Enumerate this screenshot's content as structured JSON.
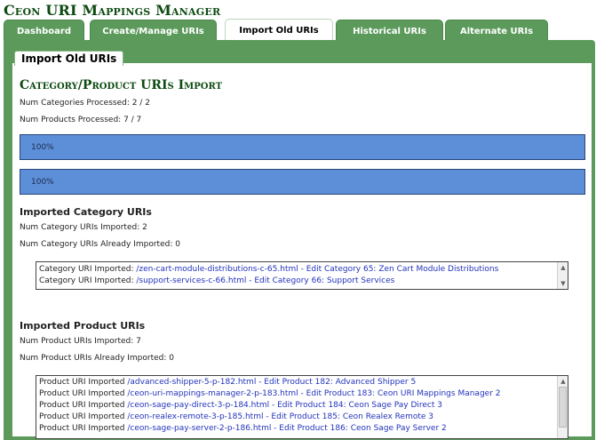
{
  "app": {
    "title": "Ceon URI Mappings Manager"
  },
  "tabs": [
    {
      "label": "Dashboard"
    },
    {
      "label": "Create/Manage URIs"
    },
    {
      "label": "Import Old URIs"
    },
    {
      "label": "Historical URIs"
    },
    {
      "label": "Alternate URIs"
    }
  ],
  "section_tab": "Import Old URIs",
  "heading": "Category/Product URIs Import",
  "stats": {
    "categories_processed": "Num Categories Processed: 2 / 2",
    "products_processed": "Num Products Processed: 7 / 7"
  },
  "progress": [
    {
      "label": "100%",
      "value": 100
    },
    {
      "label": "100%",
      "value": 100
    }
  ],
  "imported_categories": {
    "title": "Imported Category URIs",
    "num_imported": "Num Category URIs Imported: 2",
    "num_already": "Num Category URIs Already Imported: 0",
    "log": [
      {
        "prefix": "Category URI Imported: ",
        "link": "/zen-cart-module-distributions-c-65.html - Edit Category 65: Zen Cart Module Distributions"
      },
      {
        "prefix": "Category URI Imported: ",
        "link": "/support-services-c-66.html - Edit Category 66: Support Services"
      }
    ]
  },
  "imported_products": {
    "title": "Imported Product URIs",
    "num_imported": "Num Product URIs Imported: 7",
    "num_already": "Num Product URIs Already Imported: 0",
    "log": [
      {
        "prefix": "Product URI Imported ",
        "link": "/advanced-shipper-5-p-182.html - Edit Product 182: Advanced Shipper 5"
      },
      {
        "prefix": "Product URI Imported ",
        "link": "/ceon-uri-mappings-manager-2-p-183.html - Edit Product 183: Ceon URI Mappings Manager 2"
      },
      {
        "prefix": "Product URI Imported ",
        "link": "/ceon-sage-pay-direct-3-p-184.html - Edit Product 184: Ceon Sage Pay Direct 3"
      },
      {
        "prefix": "Product URI Imported ",
        "link": "/ceon-realex-remote-3-p-185.html - Edit Product 185: Ceon Realex Remote 3"
      },
      {
        "prefix": "Product URI Imported ",
        "link": "/ceon-sage-pay-server-2-p-186.html - Edit Product 186: Ceon Sage Pay Server 2"
      }
    ]
  },
  "icons": {
    "scroll_up": "▲",
    "scroll_down": "▼"
  },
  "colors": {
    "brand_green": "#0d4b12",
    "tab_green": "#5c9a5c",
    "progress_fill": "#5d8fd9",
    "link_blue": "#2233bb"
  }
}
